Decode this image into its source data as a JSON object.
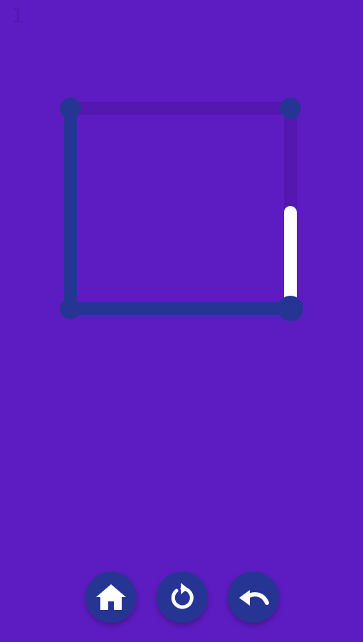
{
  "level": {
    "number": "1"
  },
  "colors": {
    "background": "#5d1cc2",
    "edge_drawn": "#263594",
    "edge_undrawn": "#5417b0",
    "node": "#263594",
    "active_line": "#ffffff",
    "button": "#263594",
    "icon": "#ffffff"
  },
  "puzzle": {
    "nodes": [
      {
        "id": "top-left",
        "drawn": false
      },
      {
        "id": "top-right",
        "drawn": false
      },
      {
        "id": "bottom-left",
        "drawn": false
      },
      {
        "id": "bottom-right",
        "drawn": false,
        "active": true
      }
    ],
    "edges": [
      {
        "from": "top-left",
        "to": "top-right",
        "drawn": false
      },
      {
        "from": "top-right",
        "to": "bottom-right",
        "drawn": false
      },
      {
        "from": "top-left",
        "to": "bottom-left",
        "drawn": true
      },
      {
        "from": "bottom-left",
        "to": "bottom-right",
        "drawn": true
      }
    ],
    "current_stroke_progress": 0.48
  },
  "controls": [
    {
      "id": "home",
      "icon": "home-icon"
    },
    {
      "id": "restart",
      "icon": "restart-icon"
    },
    {
      "id": "undo",
      "icon": "undo-icon"
    }
  ]
}
